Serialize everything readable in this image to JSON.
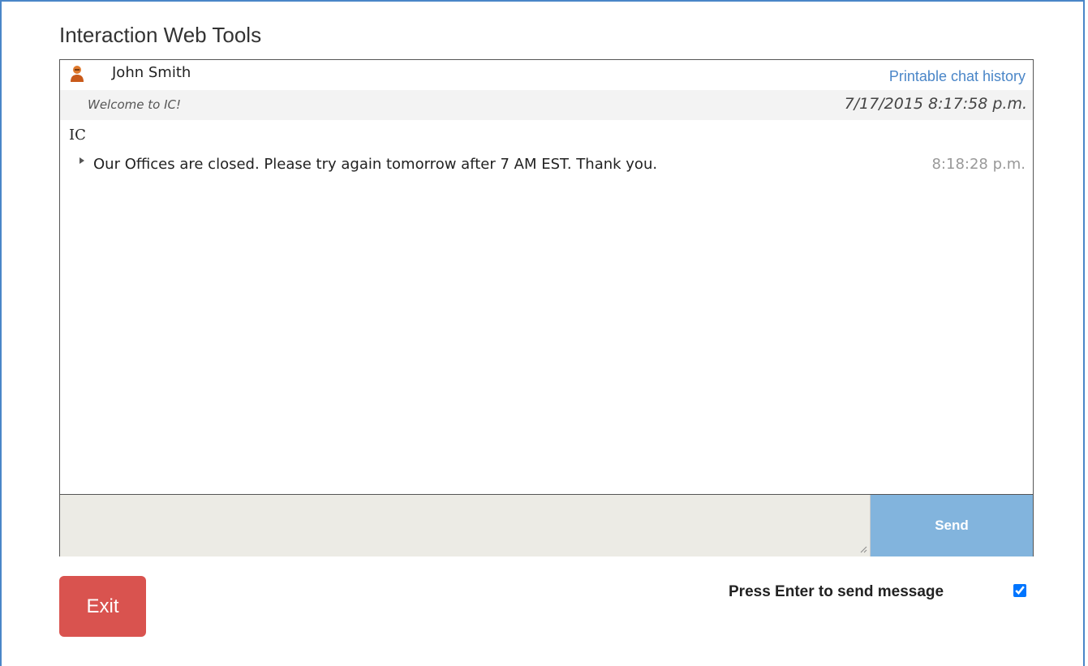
{
  "app": {
    "title": "Interaction Web Tools"
  },
  "chat_header": {
    "user_name": "John Smith",
    "user_icon": "person-icon",
    "print_link": "Printable chat history"
  },
  "welcome": {
    "text": "Welcome to IC!",
    "timestamp": "7/17/2015 8:17:58 p.m."
  },
  "messages": [
    {
      "sender": "IC",
      "text": "Our Offices are closed. Please try again tomorrow after 7 AM EST. Thank you.",
      "time": "8:18:28 p.m."
    }
  ],
  "composer": {
    "value": "",
    "send_label": "Send"
  },
  "footer": {
    "exit_label": "Exit",
    "enter_to_send_label": "Press Enter to send message",
    "enter_to_send_checked": true
  },
  "colors": {
    "frame_border": "#4a86c8",
    "link": "#4a86c8",
    "send_button": "#82b4dd",
    "exit_button": "#d9534f",
    "input_bg": "#ecebe5"
  }
}
